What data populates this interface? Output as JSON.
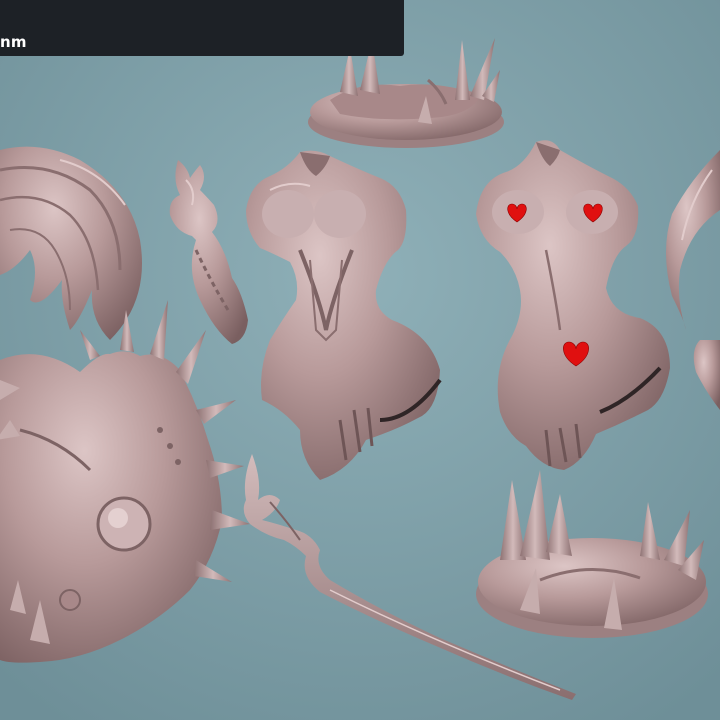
{
  "overlay": {
    "label": "nm"
  },
  "colors": {
    "background": "#86a5ad",
    "model": "#b39595",
    "model_shadow": "#7d6364",
    "model_highlight": "#d8c2c2",
    "censor_heart": "#e01010",
    "label_bar": "#1d2126",
    "label_text": "#ffffff"
  },
  "scene_parts": [
    {
      "name": "hair-piece",
      "icon": "sculpted-hair"
    },
    {
      "name": "flame-arm",
      "icon": "sculpted-arm-with-flame"
    },
    {
      "name": "torso-armored",
      "icon": "sculpted-torso"
    },
    {
      "name": "torso-censored",
      "icon": "sculpted-torso",
      "censor": "heart-icons"
    },
    {
      "name": "curved-horn",
      "icon": "sculpted-horn"
    },
    {
      "name": "spiked-base-top",
      "icon": "spiked-round-base"
    },
    {
      "name": "spiked-base-bottom",
      "icon": "spiked-round-base"
    },
    {
      "name": "dragon-head",
      "icon": "sculpted-dragon-head"
    },
    {
      "name": "staff",
      "icon": "sculpted-staff"
    }
  ]
}
